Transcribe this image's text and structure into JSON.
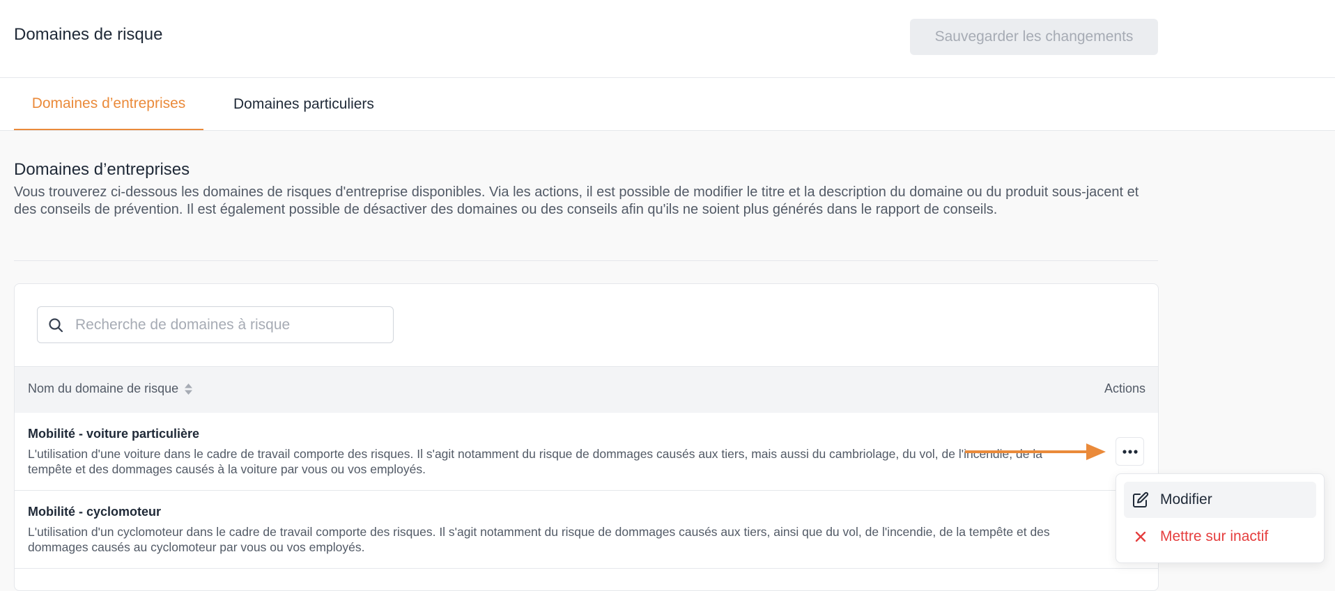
{
  "header": {
    "title": "Domaines de risque",
    "save_label": "Sauvegarder les changements"
  },
  "tabs": [
    {
      "label": "Domaines d’entreprises",
      "active": true
    },
    {
      "label": "Domaines particuliers",
      "active": false
    }
  ],
  "section": {
    "title": "Domaines d’entreprises",
    "description": "Vous trouverez ci-dessous les domaines de risques d'entreprise disponibles. Via les actions, il est possible de modifier le titre et la description du domaine ou du produit sous-jacent et des conseils de prévention. Il est également possible de désactiver des domaines ou des conseils afin qu'ils ne soient plus générés dans le rapport de conseils."
  },
  "search": {
    "placeholder": "Recherche de domaines à risque",
    "value": ""
  },
  "table": {
    "columns": {
      "name": "Nom du domaine de risque",
      "actions": "Actions"
    },
    "rows": [
      {
        "title": "Mobilité - voiture particulière",
        "description": "L'utilisation d'une voiture dans le cadre de travail comporte des risques. Il s'agit notamment du risque de dommages causés aux tiers, mais aussi du cambriolage, du vol, de l'incendie, de la tempête et des dommages causés à la voiture par vous ou vos employés."
      },
      {
        "title": "Mobilité - cyclomoteur",
        "description": "L'utilisation d'un cyclomoteur dans le cadre de travail comporte des risques. Il s'agit notamment du risque de dommages causés aux tiers, ainsi que du vol, de l'incendie, de la tempête et des dommages causés au cyclomoteur par vous ou vos employés."
      }
    ]
  },
  "menu": {
    "edit_label": "Modifier",
    "inactive_label": "Mettre sur inactif"
  },
  "icons": {
    "search": "search-icon",
    "sort": "sort-icon",
    "more": "more-horizontal-icon",
    "edit": "edit-icon",
    "close": "close-icon",
    "arrow": "arrow-right-icon"
  },
  "colors": {
    "accent": "#ea8a3a",
    "danger": "#e53e3e",
    "text": "#1f2937",
    "muted": "#525a66"
  }
}
